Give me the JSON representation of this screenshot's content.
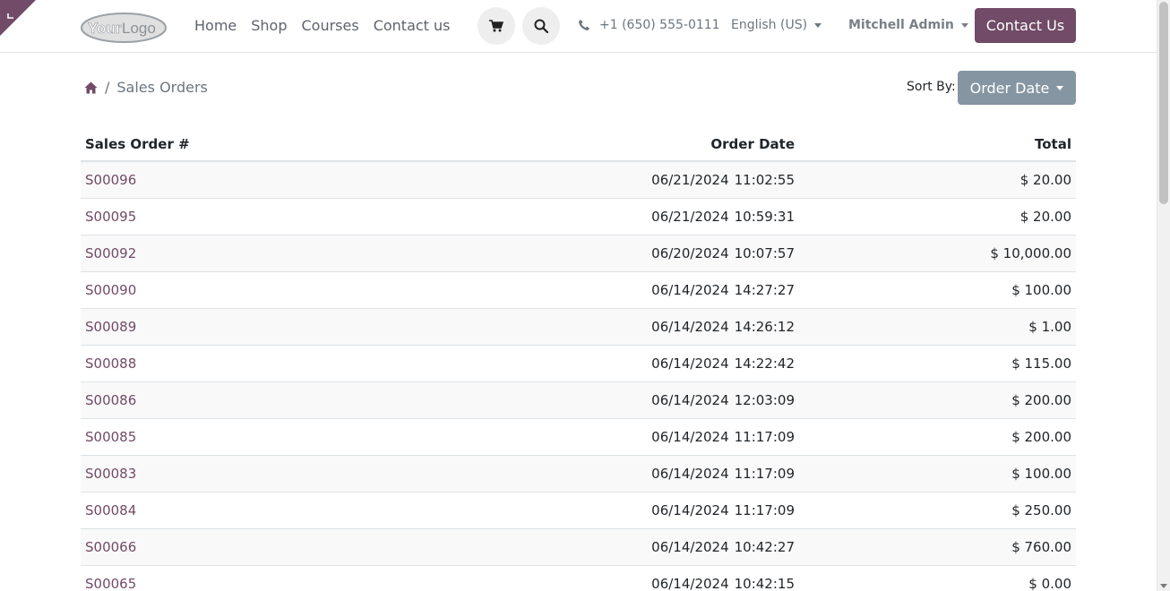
{
  "colors": {
    "brand": "#714b67",
    "sort_button": "#8595a2",
    "link": "#714b67"
  },
  "header": {
    "logo_text": "YourLogo",
    "nav": [
      "Home",
      "Shop",
      "Courses",
      "Contact us"
    ],
    "phone": "+1 (650) 555-0111",
    "language": "English (US)",
    "user": "Mitchell Admin",
    "contact_button": "Contact Us",
    "icons": {
      "cart": "cart-icon",
      "search": "search-icon",
      "phone": "phone-icon",
      "home": "home-icon"
    }
  },
  "breadcrumb": {
    "separator": "/",
    "current": "Sales Orders"
  },
  "sort": {
    "label": "Sort By:",
    "selected": "Order Date"
  },
  "table": {
    "headers": [
      "Sales Order #",
      "Order Date",
      "Total"
    ],
    "rows": [
      {
        "order": "S00096",
        "date": "06/21/2024",
        "time": "11:02:55",
        "total": "$ 20.00"
      },
      {
        "order": "S00095",
        "date": "06/21/2024",
        "time": "10:59:31",
        "total": "$ 20.00"
      },
      {
        "order": "S00092",
        "date": "06/20/2024",
        "time": "10:07:57",
        "total": "$ 10,000.00"
      },
      {
        "order": "S00090",
        "date": "06/14/2024",
        "time": "14:27:27",
        "total": "$ 100.00"
      },
      {
        "order": "S00089",
        "date": "06/14/2024",
        "time": "14:26:12",
        "total": "$ 1.00"
      },
      {
        "order": "S00088",
        "date": "06/14/2024",
        "time": "14:22:42",
        "total": "$ 115.00"
      },
      {
        "order": "S00086",
        "date": "06/14/2024",
        "time": "12:03:09",
        "total": "$ 200.00"
      },
      {
        "order": "S00085",
        "date": "06/14/2024",
        "time": "11:17:09",
        "total": "$ 200.00"
      },
      {
        "order": "S00083",
        "date": "06/14/2024",
        "time": "11:17:09",
        "total": "$ 100.00"
      },
      {
        "order": "S00084",
        "date": "06/14/2024",
        "time": "11:17:09",
        "total": "$ 250.00"
      },
      {
        "order": "S00066",
        "date": "06/14/2024",
        "time": "10:42:27",
        "total": "$ 760.00"
      },
      {
        "order": "S00065",
        "date": "06/14/2024",
        "time": "10:42:15",
        "total": "$ 0.00"
      }
    ]
  }
}
